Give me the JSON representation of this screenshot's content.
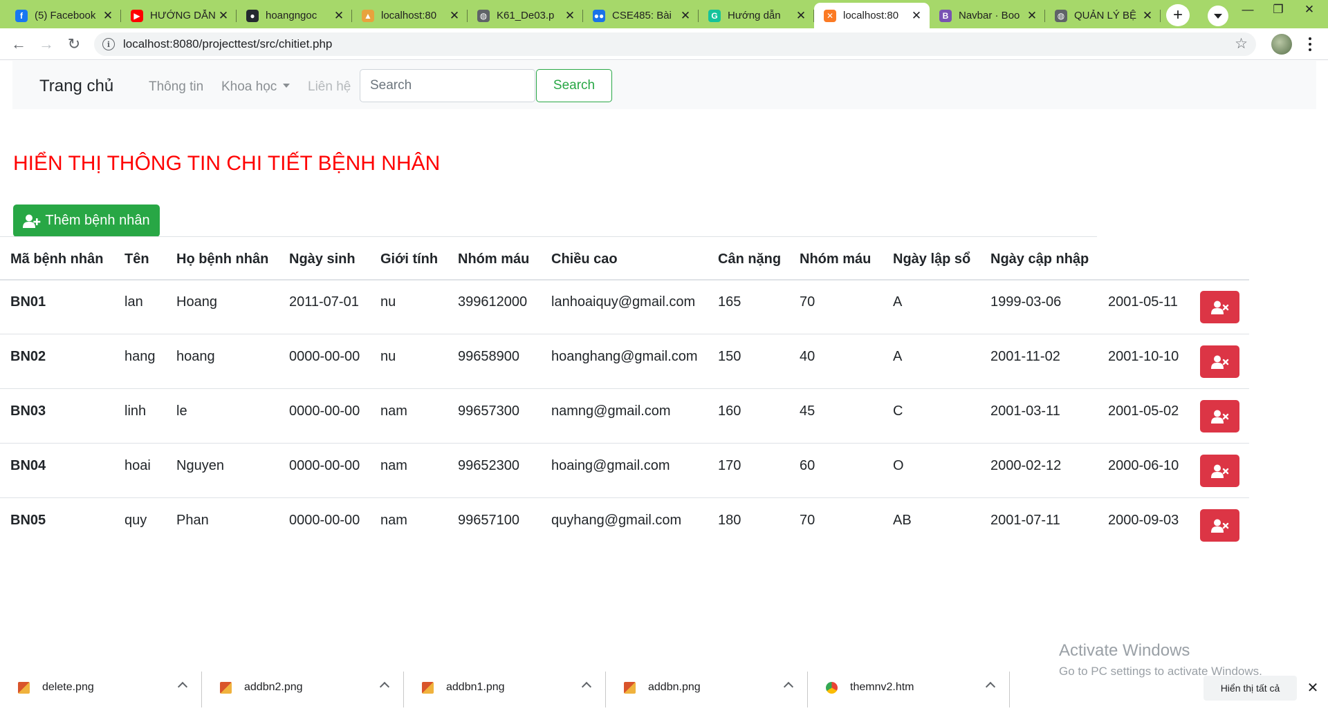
{
  "browser": {
    "tabs": [
      {
        "title": "(5) Facebook",
        "favicon": "facebook-icon",
        "color": "#1877f2",
        "glyph": "f"
      },
      {
        "title": "HƯỚNG DẪN",
        "favicon": "youtube-icon",
        "color": "#ff0000",
        "glyph": "▶"
      },
      {
        "title": "hoangngoc",
        "favicon": "github-icon",
        "color": "#24292f",
        "glyph": "●"
      },
      {
        "title": "localhost:80",
        "favicon": "phpmyadmin-icon",
        "color": "#e8a33d",
        "glyph": "▲"
      },
      {
        "title": "K61_De03.p",
        "favicon": "globe-icon",
        "color": "#5f6368",
        "glyph": "◍"
      },
      {
        "title": "CSE485: Bài",
        "favicon": "dots-icon",
        "color": "#1a73e8",
        "glyph": "●●"
      },
      {
        "title": "Hướng dẫn",
        "favicon": "grammarly-icon",
        "color": "#15c39a",
        "glyph": "G"
      },
      {
        "title": "localhost:80",
        "favicon": "xampp-icon",
        "color": "#fb7a24",
        "glyph": "✕",
        "active": true
      },
      {
        "title": "Navbar · Boo",
        "favicon": "bootstrap-icon",
        "color": "#7952b3",
        "glyph": "B"
      },
      {
        "title": "QUẢN LÝ BỆ",
        "favicon": "globe-icon",
        "color": "#5f6368",
        "glyph": "◍"
      }
    ],
    "url": "localhost:8080/projecttest/src/chitiet.php"
  },
  "navbar": {
    "brand": "Trang chủ",
    "links": [
      "Thông tin",
      "Khoa học",
      "Liên hệ"
    ],
    "search_placeholder": "Search",
    "search_button": "Search"
  },
  "page": {
    "title": "HIỂN THỊ THÔNG TIN CHI TIẾT BỆNH NHÂN",
    "add_button": "Thêm bệnh nhân"
  },
  "table": {
    "headers": [
      "Mã bệnh nhân",
      "Tên",
      "Họ bệnh nhân",
      "Ngày sinh",
      "Giới tính",
      "Nhóm máu",
      "Chiều cao",
      "Cân nặng",
      "Nhóm máu",
      "Ngày lập sổ",
      "Ngày cập nhập"
    ],
    "rows": [
      [
        "BN01",
        "lan",
        "Hoang",
        "2011-07-01",
        "nu",
        "399612000",
        "lanhoaiquy@gmail.com",
        "165",
        "70",
        "A",
        "1999-03-06",
        "2001-05-11"
      ],
      [
        "BN02",
        "hang",
        "hoang",
        "0000-00-00",
        "nu",
        "99658900",
        "hoanghang@gmail.com",
        "150",
        "40",
        "A",
        "2001-11-02",
        "2001-10-10"
      ],
      [
        "BN03",
        "linh",
        "le",
        "0000-00-00",
        "nam",
        "99657300",
        "namng@gmail.com",
        "160",
        "45",
        "C",
        "2001-03-11",
        "2001-05-02"
      ],
      [
        "BN04",
        "hoai",
        "Nguyen",
        "0000-00-00",
        "nam",
        "99652300",
        "hoaing@gmail.com",
        "170",
        "60",
        "O",
        "2000-02-12",
        "2000-06-10"
      ],
      [
        "BN05",
        "quy",
        "Phan",
        "0000-00-00",
        "nam",
        "99657100",
        "quyhang@gmail.com",
        "180",
        "70",
        "AB",
        "2001-07-11",
        "2000-09-03"
      ]
    ]
  },
  "windows": {
    "activate_title": "Activate Windows",
    "activate_sub": "Go to PC settings to activate Windows."
  },
  "downloads": {
    "items": [
      {
        "name": "delete.png",
        "icon": "image-file-icon"
      },
      {
        "name": "addbn2.png",
        "icon": "image-file-icon"
      },
      {
        "name": "addbn1.png",
        "icon": "image-file-icon"
      },
      {
        "name": "addbn.png",
        "icon": "image-file-icon"
      },
      {
        "name": "themnv2.htm",
        "icon": "chrome-file-icon"
      }
    ],
    "show_all": "Hiển thị tất cả"
  },
  "colors": {
    "tabstrip": "#a6d86a",
    "title": "#ff0000",
    "success": "#28a745",
    "danger": "#dc3545"
  }
}
